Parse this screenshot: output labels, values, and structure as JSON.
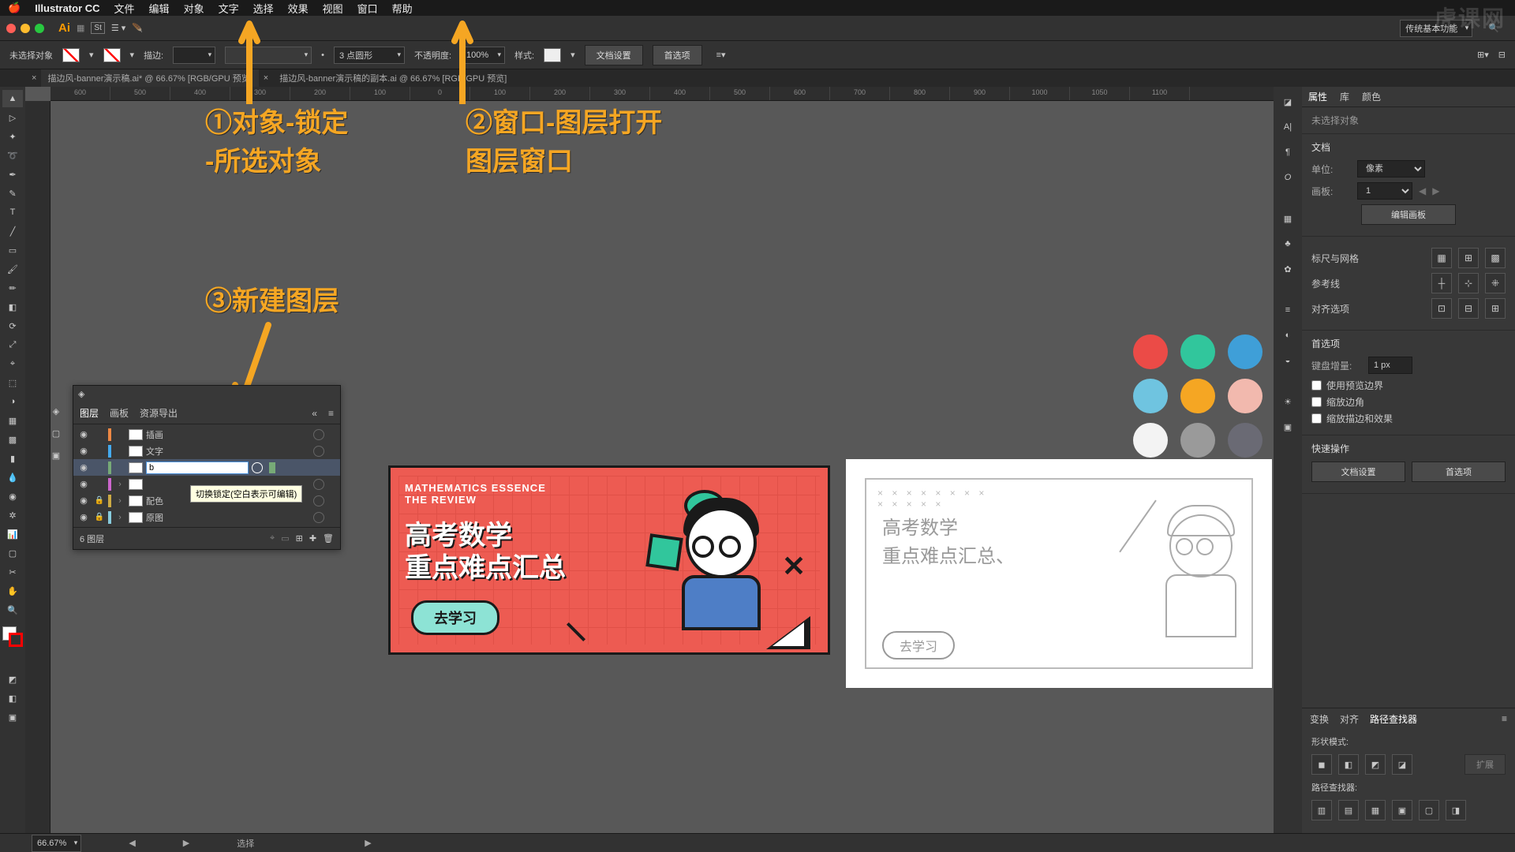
{
  "menubar": {
    "app": "Illustrator CC",
    "items": [
      "文件",
      "编辑",
      "对象",
      "文字",
      "选择",
      "效果",
      "视图",
      "窗口",
      "帮助"
    ]
  },
  "topbar": {
    "workspace": "传统基本功能"
  },
  "controlbar": {
    "noselection": "未选择对象",
    "stroke_label": "描边:",
    "stroke_val": "",
    "stroke_style": "3 点圆形",
    "opacity_label": "不透明度:",
    "opacity_val": "100%",
    "style_label": "样式:",
    "docset": "文档设置",
    "prefs": "首选项"
  },
  "tabs": [
    {
      "name": "描边风-banner演示稿.ai* @ 66.67% [RGB/GPU 预览]",
      "active": true
    },
    {
      "name": "描边风-banner演示稿的副本.ai @ 66.67% [RGB/GPU 预览]",
      "active": false
    }
  ],
  "ruler_ticks": [
    "600",
    "500",
    "400",
    "300",
    "200",
    "100",
    "0",
    "100",
    "200",
    "300",
    "400",
    "500",
    "600",
    "700",
    "800",
    "900",
    "1000",
    "1050",
    "1100"
  ],
  "annotations": {
    "a1": "①对象-锁定\n-所选对象",
    "a2": "②窗口-图层打开\n图层窗口",
    "a3": "③新建图层"
  },
  "artwork": {
    "en1": "MATHEMATICS ESSENCE",
    "en2": "THE REVIEW",
    "cn1": "高考数学",
    "cn2": "重点难点汇总",
    "btn": "去学习"
  },
  "sketch": {
    "l1": "高考数学",
    "l2": "重点难点汇总、",
    "btn": "去学习"
  },
  "palette": [
    "#eb4b47",
    "#31c69c",
    "#3f9fd8",
    "#6fc4e0",
    "#f5a623",
    "#f2b9ae",
    "#f3f3f3",
    "#9a9a9a",
    "#6a6a74"
  ],
  "layers_panel": {
    "tabs": [
      "图层",
      "画板",
      "资源导出"
    ],
    "rows": [
      {
        "name": "插画",
        "vis": true,
        "lock": false,
        "expand": false,
        "color": "#e84"
      },
      {
        "name": "文字",
        "vis": true,
        "lock": false,
        "expand": false,
        "color": "#4ae"
      },
      {
        "name": "b",
        "vis": true,
        "lock": false,
        "expand": false,
        "editing": true,
        "sel": true,
        "color": "#7a7"
      },
      {
        "name": "",
        "vis": true,
        "lock": false,
        "expand": true,
        "color": "#c6c"
      },
      {
        "name": "配色",
        "vis": true,
        "lock": true,
        "expand": true,
        "color": "#ca4"
      },
      {
        "name": "原图",
        "vis": true,
        "lock": true,
        "expand": true,
        "color": "#8cd"
      }
    ],
    "tooltip": "切换锁定(空白表示可编辑)",
    "footer": "6 图层"
  },
  "prop_panel": {
    "tabs": [
      "属性",
      "库",
      "颜色"
    ],
    "noselect": "未选择对象",
    "doc": "文档",
    "unit_label": "单位:",
    "unit_val": "像素",
    "artboard_label": "画板:",
    "artboard_val": "1",
    "edit_artboards": "编辑画板",
    "ruler_grid": "标尺与网格",
    "guides": "参考线",
    "align": "对齐选项",
    "prefs_hdr": "首选项",
    "kbd_inc": "键盘增量:",
    "kbd_val": "1 px",
    "chk1": "使用预览边界",
    "chk2": "缩放边角",
    "chk3": "缩放描边和效果",
    "quick": "快速操作",
    "btn_doc": "文档设置",
    "btn_pref": "首选项"
  },
  "pathfinder": {
    "tabs": [
      "变换",
      "对齐",
      "路径查找器"
    ],
    "shape_mode": "形状模式:",
    "expand": "扩展",
    "pf": "路径查找器:"
  },
  "statusbar": {
    "zoom": "66.67%",
    "sel": "选择"
  },
  "watermark": "虎课网"
}
